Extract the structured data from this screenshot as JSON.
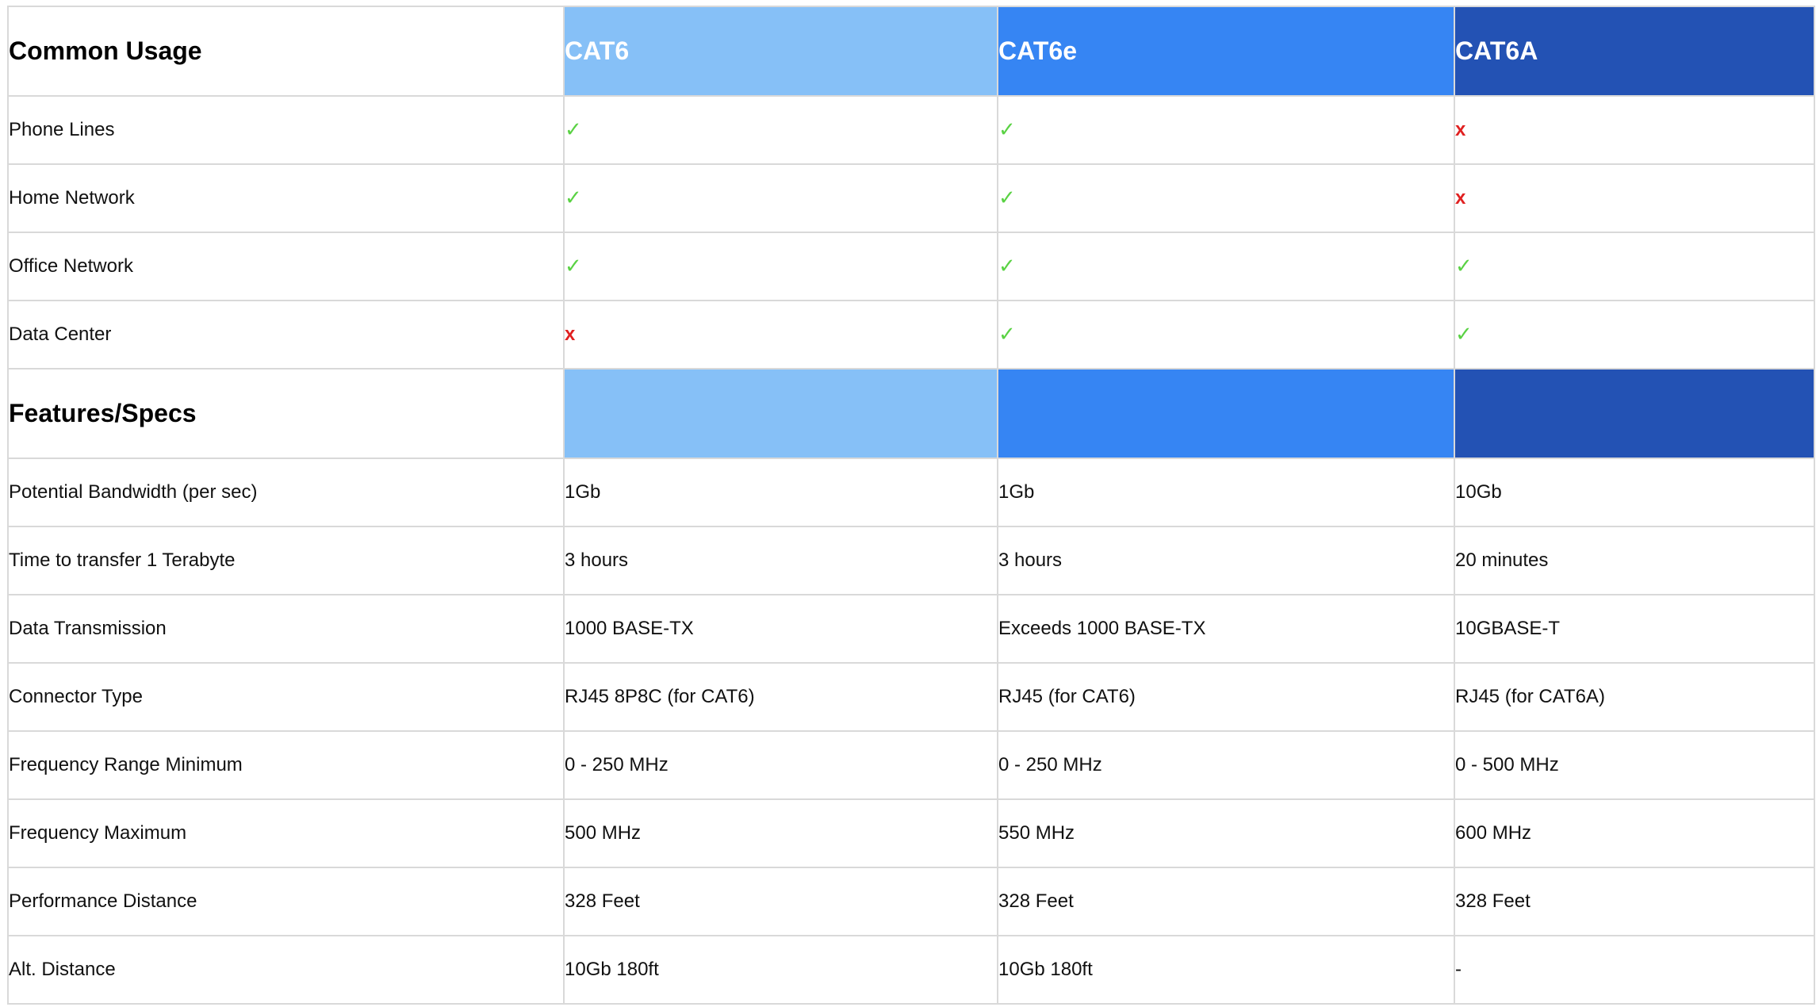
{
  "columns": [
    "CAT6",
    "CAT6e",
    "CAT6A"
  ],
  "colors": {
    "cat6": "#86c0f7",
    "cat6e": "#3685f3",
    "cat6a": "#2352b4",
    "check": "#5ad244",
    "cross": "#e02020",
    "grid": "#d9d9d9"
  },
  "symbols": {
    "yes": "✓",
    "no": "x"
  },
  "common_usage": {
    "title": "Common Usage",
    "rows": [
      {
        "label": "Phone Lines",
        "marks": [
          "yes",
          "yes",
          "no"
        ]
      },
      {
        "label": "Home Network",
        "marks": [
          "yes",
          "yes",
          "no"
        ]
      },
      {
        "label": "Office Network",
        "marks": [
          "yes",
          "yes",
          "yes"
        ]
      },
      {
        "label": "Data Center",
        "marks": [
          "no",
          "yes",
          "yes"
        ]
      }
    ]
  },
  "features": {
    "title": "Features/Specs",
    "rows": [
      {
        "label": "Potential Bandwidth (per sec)",
        "values": [
          "1Gb",
          "1Gb",
          "10Gb"
        ]
      },
      {
        "label": "Time to transfer 1 Terabyte",
        "values": [
          "3 hours",
          "3 hours",
          "20 minutes"
        ]
      },
      {
        "label": "Data Transmission",
        "values": [
          "1000 BASE-TX",
          "Exceeds 1000 BASE-TX",
          "10GBASE-T"
        ]
      },
      {
        "label": "Connector Type",
        "values": [
          "RJ45 8P8C (for CAT6)",
          "RJ45 (for CAT6)",
          "RJ45 (for CAT6A)"
        ]
      },
      {
        "label": "Frequency Range Minimum",
        "values": [
          "0 - 250 MHz",
          "0 - 250 MHz",
          "0 - 500 MHz"
        ]
      },
      {
        "label": "Frequency Maximum",
        "values": [
          "500 MHz",
          "550 MHz",
          "600 MHz"
        ]
      },
      {
        "label": "Performance Distance",
        "values": [
          "328 Feet",
          "328 Feet",
          "328 Feet"
        ]
      },
      {
        "label": "Alt. Distance",
        "values": [
          "10Gb 180ft",
          "10Gb 180ft",
          "-"
        ]
      }
    ]
  }
}
